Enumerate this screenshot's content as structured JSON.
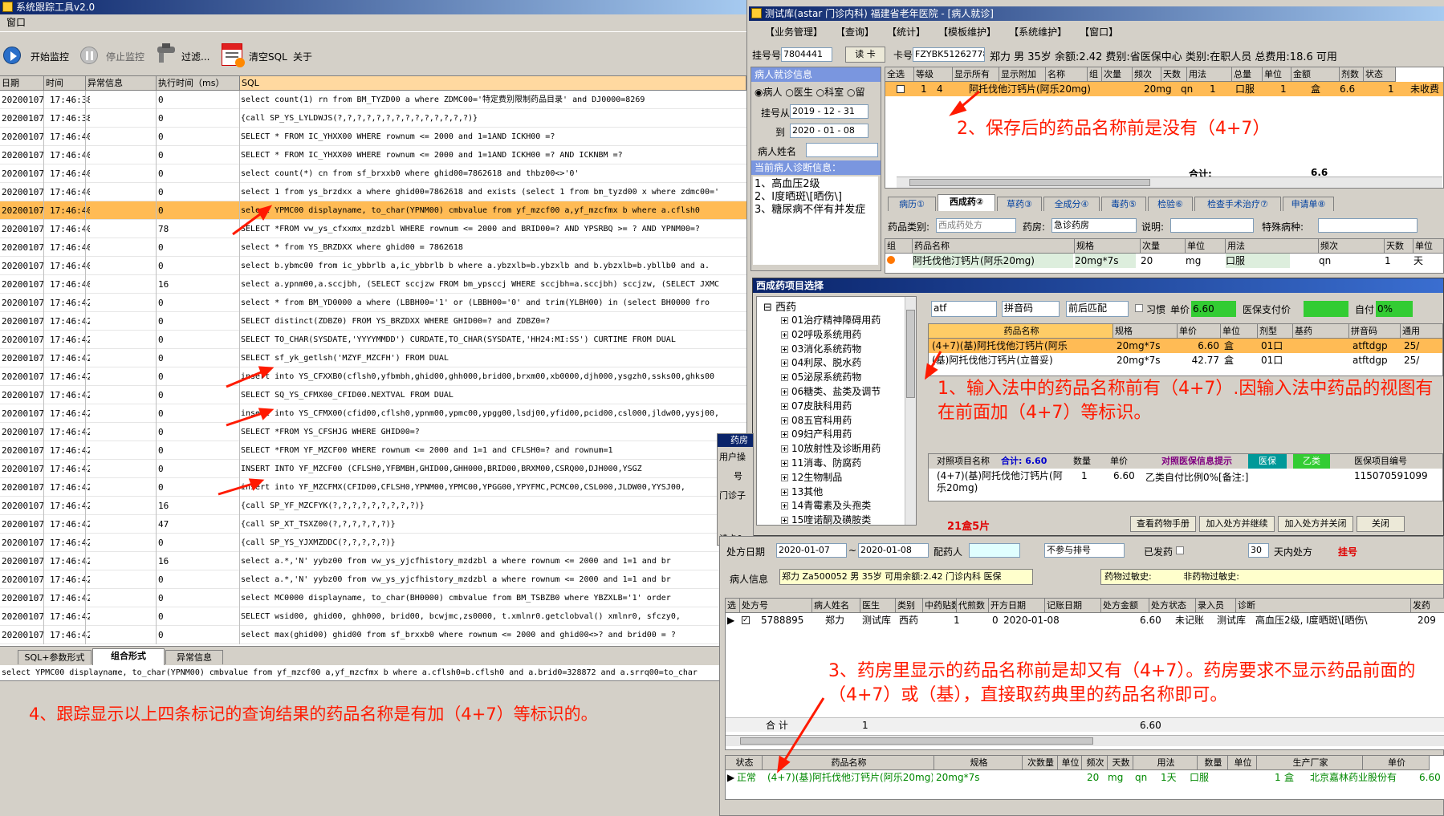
{
  "left_window": {
    "title": "系统跟踪工具v2.0",
    "menu": [
      "窗口"
    ],
    "toolbar": {
      "start": "开始监控",
      "stop": "停止监控",
      "filter": "过滤...",
      "clear": "清空SQL",
      "about": "关于"
    },
    "columns": [
      "日期",
      "时间",
      "异常信息",
      "执行时间（ms）",
      "SQL"
    ],
    "rows": [
      {
        "d": "20200107",
        "t": "17:46:38",
        "ms": "0",
        "sql": "select count(1) rn from BM_TYZD00 a where ZDMC00='特定费别限制药品目录' and DJ0000=8269"
      },
      {
        "d": "20200107",
        "t": "17:46:38",
        "ms": "0",
        "sql": "{call SP_YS_LYLDWJS(?,?,?,?,?,?,?,?,?,?,?,?,?,?)}"
      },
      {
        "d": "20200107",
        "t": "17:46:40",
        "ms": "0",
        "sql": "SELECT * FROM IC_YHXX00 WHERE rownum <= 2000 and  1=1AND ICKH00 =?"
      },
      {
        "d": "20200107",
        "t": "17:46:40",
        "ms": "0",
        "sql": "SELECT * FROM IC_YHXX00 WHERE rownum <= 2000 and  1=1AND ICKH00 =? AND ICKNBM =?"
      },
      {
        "d": "20200107",
        "t": "17:46:40",
        "ms": "0",
        "sql": "select count(*) cn from sf_brxxb0 where ghid00=7862618 and thbz00<>'0'"
      },
      {
        "d": "20200107",
        "t": "17:46:40",
        "ms": "0",
        "sql": "select 1 from ys_brzdxx a where ghid00=7862618 and exists (select 1 from bm_tyzd00 x where zdmc00='"
      },
      {
        "d": "20200107",
        "t": "17:46:40",
        "ms": "0",
        "sql": "select YPMC00  displayname, to_char(YPNM00)  cmbvalue from yf_mzcf00 a,yf_mzcfmx b   where a.cflsh0",
        "hl": true
      },
      {
        "d": "20200107",
        "t": "17:46:40",
        "ms": "78",
        "sql": "SELECT *FROM vw_ys_cfxxmx_mzdzbl WHERE rownum <= 2000 and   BRID00=?  AND YPSRBQ >= ?  AND YPNM00=?"
      },
      {
        "d": "20200107",
        "t": "17:46:40",
        "ms": "0",
        "sql": "select * from YS_BRZDXX where ghid00 = 7862618"
      },
      {
        "d": "20200107",
        "t": "17:46:40",
        "ms": "0",
        "sql": "select b.ybmc00 from ic_ybbrlb a,ic_ybbrlb b where a.ybzxlb=b.ybzxlb  and b.ybzxlb=b.ybllb0 and a."
      },
      {
        "d": "20200107",
        "t": "17:46:40",
        "ms": "16",
        "sql": " select a.ypnm00,a.sccjbh, (SELECT sccjzw FROM bm_ypsccj WHERE sccjbh=a.sccjbh) sccjzw, (SELECT JXMC"
      },
      {
        "d": "20200107",
        "t": "17:46:42",
        "ms": "0",
        "sql": " select * from BM_YD0000 a where (LBBH00='1' or (LBBH00='0' and trim(YLBH00) in (select BH0000 fro"
      },
      {
        "d": "20200107",
        "t": "17:46:42",
        "ms": "0",
        "sql": "SELECT distinct(ZDBZ0) FROM YS_BRZDXX WHERE GHID00=? and ZDBZ0=?"
      },
      {
        "d": "20200107",
        "t": "17:46:42",
        "ms": "0",
        "sql": "SELECT TO_CHAR(SYSDATE,'YYYYMMDD') CURDATE,TO_CHAR(SYSDATE,'HH24:MI:SS') CURTIME FROM DUAL"
      },
      {
        "d": "20200107",
        "t": "17:46:42",
        "ms": "0",
        "sql": "SELECT sf_yk_getlsh('MZYF_MZCFH') FROM DUAL"
      },
      {
        "d": "20200107",
        "t": "17:46:42",
        "ms": "0",
        "sql": "insert into YS_CFXXB0(cflsh0,yfbmbh,ghid00,ghh000,brid00,brxm00,xb0000,djh000,ysgzh0,ssks00,ghks00"
      },
      {
        "d": "20200107",
        "t": "17:46:42",
        "ms": "0",
        "sql": "SELECT SQ_YS_CFMX00_CFID00.NEXTVAL FROM DUAL"
      },
      {
        "d": "20200107",
        "t": "17:46:42",
        "ms": "0",
        "sql": "insert into YS_CFMX00(cfid00,cflsh0,ypnm00,ypmc00,ypgg00,lsdj00,yfid00,pcid00,csl000,jldw00,yysj00,"
      },
      {
        "d": "20200107",
        "t": "17:46:42",
        "ms": "0",
        "sql": "SELECT  *FROM YS_CFSHJG WHERE GHID00=?"
      },
      {
        "d": "20200107",
        "t": "17:46:42",
        "ms": "0",
        "sql": "SELECT  *FROM YF_MZCF00 WHERE rownum <= 2000 and  1=1 and CFLSH0=? and rownum=1"
      },
      {
        "d": "20200107",
        "t": "17:46:42",
        "ms": "0",
        "sql": " INSERT  INTO YF_MZCF00  (CFLSH0,YFBMBH,GHID00,GHH000,BRID00,BRXM00,CSRQ00,DJH000,YSGZ"
      },
      {
        "d": "20200107",
        "t": "17:46:42",
        "ms": "0",
        "sql": "insert into YF_MZCFMX(CFID00,CFLSH0,YPNM00,YPMC00,YPGG00,YPYFMC,PCMC00,CSL000,JLDW00,YYSJ00,"
      },
      {
        "d": "20200107",
        "t": "17:46:42",
        "ms": "16",
        "sql": "{call SP_YF_MZCFYK(?,?,?,?,?,?,?,?,?)}"
      },
      {
        "d": "20200107",
        "t": "17:46:42",
        "ms": "47",
        "sql": "{call SP_XT_TSXZ00(?,?,?,?,?,?)}"
      },
      {
        "d": "20200107",
        "t": "17:46:42",
        "ms": "0",
        "sql": "{call SP_YS_YJXMZDDC(?,?,?,?,?)}"
      },
      {
        "d": "20200107",
        "t": "17:46:42",
        "ms": "16",
        "sql": " select a.*,'N' yybz00 from vw_ys_yjcfhistory_mzdzbl a where rownum <= 2000 and  1=1  and br"
      },
      {
        "d": "20200107",
        "t": "17:46:42",
        "ms": "0",
        "sql": " select a.*,'N' yybz00 from vw_ys_yjcfhistory_mzdzbl a where rownum <= 2000 and  1=1  and br"
      },
      {
        "d": "20200107",
        "t": "17:46:42",
        "ms": "0",
        "sql": "select MC0000  displayname, to_char(BH0000)  cmbvalue from BM_TSBZB0  where YBZXLB='1' order"
      },
      {
        "d": "20200107",
        "t": "17:46:42",
        "ms": "0",
        "sql": "SELECT wsid00, ghid00, ghh000, brid00, bcwjmc,zs0000,  t.xmlnr0.getclobval() xmlnr0, sfczy0,"
      },
      {
        "d": "20200107",
        "t": "17:46:42",
        "ms": "0",
        "sql": " select max(ghid00) ghid00 from sf_brxxb0 where rownum <= 2000 and  ghid00<>? and brid00 = ?"
      }
    ],
    "tabs": [
      "SQL+参数形式",
      "组合形式",
      "异常信息"
    ],
    "status_sql": "select YPMC00  displayname, to_char(YPNM00)  cmbvalue from yf_mzcf00 a,yf_mzcfmx b   where a.cflsh0=b.cflsh0 and a.brid0=328872 and a.srrq00=to_char"
  },
  "right_window": {
    "title": "测试库(astar 门诊内科) 福建省老年医院 - [病人就诊]",
    "menu": [
      "【业务管理】",
      "【查询】",
      "【统计】",
      "【模板维护】",
      "【系统维护】",
      "【窗口】"
    ],
    "reg_label": "挂号号",
    "reg_no": "7804441",
    "card_btn": "读 卡",
    "card_label": "卡号",
    "card_no": "FZYBK51262778",
    "patient_info": "郑力  男  35岁  余额:2.42  费别:省医保中心  类别:在职人员  总费用:18.6  可用",
    "left_panel": {
      "title": "病人就诊信息",
      "radios": [
        "病人",
        "医生",
        "科室",
        "留"
      ],
      "date_from_label": "挂号从",
      "date_from": "2019 - 12 - 31",
      "date_to_label": "到",
      "date_to": "2020 - 01 - 08",
      "name_label": "病人姓名",
      "diag_title": "当前病人诊断信息：",
      "diag_text": "1、高血压2级\n2、Ⅰ度晒斑\\[晒伤\\]\n3、糖尿病不伴有并发症"
    },
    "top_grid": {
      "columns": [
        "全选",
        "等级",
        "显示所有",
        "显示附加",
        "名称",
        "组",
        "次量",
        "频次",
        "天数",
        "用法",
        "总量",
        "单位",
        "金额",
        "剂数",
        "状态"
      ],
      "row": {
        "no": "1",
        "level": "4",
        "name": "阿托伐他汀钙片(阿乐20mg)",
        "dose": "20mg",
        "freq": "qn",
        "days": "1",
        "usage": "口服",
        "total": "1",
        "unit": "盒",
        "amount": "6.6",
        "doses": "1",
        "status": "未收费"
      },
      "total_label": "合计:",
      "total_value": "6.6"
    },
    "tabs2": [
      "病历①",
      "西成药②",
      "草药③",
      "全成分④",
      "毒药⑤",
      "检验⑥",
      "检查手术治疗⑦",
      "申请单⑧"
    ],
    "drug_type_label": "药品类别:",
    "drug_type": "西成药处方",
    "pharmacy_label": "药房:",
    "pharmacy": "急诊药房",
    "note_label": "说明:",
    "special_label": "特殊病种:",
    "rx_grid": {
      "columns": [
        "组",
        "药品名称",
        "规格",
        "次量",
        "单位",
        "用法",
        "频次",
        "天数",
        "单位"
      ],
      "row": {
        "name": "阿托伐他汀钙片(阿乐20mg)",
        "spec": "20mg*7s",
        "dose": "20",
        "unit": "mg",
        "usage": "口服",
        "freq": "qn",
        "days": "1",
        "dunit": "天"
      }
    }
  },
  "drug_select": {
    "title": "西成药项目选择",
    "tree_root": "西药",
    "tree_items": [
      "01治疗精神障碍用药",
      "02呼吸系统用药",
      "03消化系统药物",
      "04利尿、脱水药",
      "05泌尿系统药物",
      "06糖类、盐类及调节",
      "07皮肤科用药",
      "08五官科用药",
      "09妇产科用药",
      "10放射性及诊断用药",
      "11消毒、防腐药",
      "12生物制品",
      "13其他",
      "14青霉素及头孢类",
      "15喹诺酮及磺胺类"
    ],
    "search_value": "atf",
    "search_mode": "拼音码",
    "match_mode": "前后匹配",
    "habit_label": "习惯",
    "price_label": "单价",
    "price_value": "6.60",
    "insure_label": "医保支付价",
    "self_label": "自付",
    "self_value": "0%",
    "columns": [
      "药品名称",
      "规格",
      "单价",
      "单位",
      "剂型",
      "基药",
      "拼音码",
      "通用"
    ],
    "rows": [
      {
        "name": "(4+7)(基)阿托伐他汀钙片(阿乐",
        "spec": "20mg*7s",
        "price": "6.60",
        "unit": "盒",
        "form": "01口",
        "py": "atftdgp",
        "gen": "25/"
      },
      {
        "name": "(基)阿托伐他汀钙片(立普妥)",
        "spec": "20mg*7s",
        "price": "42.77",
        "unit": "盒",
        "form": "01口",
        "py": "atftdgp",
        "gen": "25/"
      }
    ],
    "compare": {
      "col_name": "对照项目名称",
      "total": "合计: 6.60",
      "col_qty": "数量",
      "col_price": "单价",
      "hint": "对照医保信息提示",
      "badge1": "医保",
      "badge2": "乙类",
      "col_code": "医保项目编号",
      "name": "(4+7)(基)阿托伐他汀钙片(阿乐20mg)",
      "qty": "1",
      "price": "6.60",
      "note": "乙类自付比例0%[备注:]",
      "code": "115070591099"
    },
    "stock": "21盒5片",
    "buttons": [
      "查看药物手册",
      "加入处方并继续",
      "加入处方并关闭",
      "关闭"
    ]
  },
  "pharmacy_window": {
    "title_short": "药房",
    "side_labels": [
      "用户操",
      "号",
      "门诊子",
      "读卡0"
    ],
    "date_label": "处方日期",
    "date_from": "2020-01-07",
    "date_to": "2020-01-08",
    "dispenser_label": "配药人",
    "sort_value": "不参与排号",
    "dispensed_label": "已发药",
    "days_value": "30",
    "days_label": "天内处方",
    "reg_link": "挂号",
    "patient_label": "病人信息",
    "patient_value": "郑力 Za500052 男 35岁 可用余额:2.42 门诊内科 医保",
    "allergy_label": "药物过敏史:",
    "allergy_value": "非药物过敏史:",
    "columns": [
      "选",
      "处方号",
      "病人姓名",
      "医生",
      "类别",
      "中药贴数",
      "代煎数",
      "开方日期",
      "记账日期",
      "处方金额",
      "处方状态",
      "录入员",
      "诊断",
      "发药"
    ],
    "row": {
      "no": "5788895",
      "name": "郑力",
      "doctor": "测试库",
      "type": "西药",
      "tie": "1",
      "daijian": "0",
      "date": "2020-01-08",
      "amount": "6.60",
      "state": "未记账",
      "entry": "测试库",
      "diag": "高血压2级, Ⅰ度晒斑\\[晒伤\\",
      "fa": "209"
    },
    "sum_label": "合  计",
    "sum_count": "1",
    "sum_amount": "6.60",
    "columns2": [
      "状态",
      "药品名称",
      "规格",
      "次数量",
      "单位",
      "频次",
      "天数",
      "用法",
      "数量",
      "单位",
      "生产厂家",
      "单价"
    ],
    "row2": {
      "state": "正常",
      "name": "(4+7)(基)阿托伐他汀钙片(阿乐20mg)",
      "spec": "20mg*7s",
      "qty": "20",
      "unit": "mg",
      "freq": "qn",
      "days": "1天",
      "usage": "口服",
      "count": "1",
      "cunit": "盒",
      "maker": "北京嘉林药业股份有",
      "price": "6.60"
    }
  },
  "annotations": {
    "a1": "1、输入法中的药品名称前有（4+7）.因输入法中药品的视图有在前面加（4+7）等标识。",
    "a2": "2、保存后的药品名称前是没有（4+7）",
    "a3": "3、药房里显示的药品名称前是却又有（4+7）。药房要求不显示药品前面的（4+7）或（基），直接取药典里的药品名称即可。",
    "a4": "4、跟踪显示以上四条标记的查询结果的药品名称是有加（4+7）等标识的。"
  },
  "colors": {
    "title_blue": "#0a246a",
    "highlight_orange": "#ffbb55",
    "annotation_red": "#ff1a00",
    "selection_blue": "#316ac5",
    "green_cell": "#33cc33"
  }
}
